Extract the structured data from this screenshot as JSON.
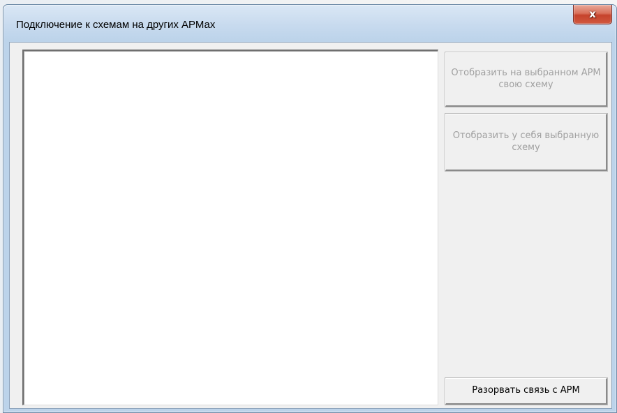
{
  "window": {
    "title": "Подключение к схемам на других АРМах",
    "close_glyph": "x"
  },
  "list": {
    "items": []
  },
  "buttons": {
    "show_my_scheme_label": "Отобразить на выбранном АРМ свою схему",
    "show_selected_scheme_label": "Отобразить у себя выбранную схему",
    "disconnect_label": "Разорвать связь с АРМ"
  },
  "colors": {
    "title_bar": "#c7daee",
    "close_button": "#c5432c",
    "client_background": "#f0f0f0",
    "disabled_text": "#a0a0a0"
  }
}
